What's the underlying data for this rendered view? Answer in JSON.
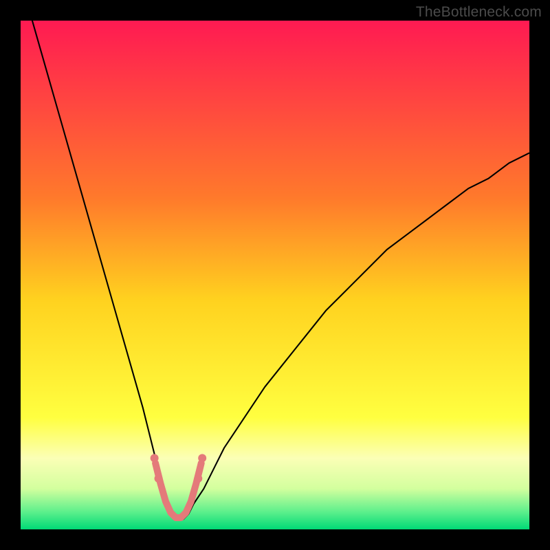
{
  "watermark": "TheBottleneck.com",
  "chart_data": {
    "type": "line",
    "title": "",
    "xlabel": "",
    "ylabel": "",
    "xlim": [
      0,
      100
    ],
    "ylim": [
      0,
      100
    ],
    "background_gradient_stops": [
      {
        "offset": 0.0,
        "color": "#ff1a52"
      },
      {
        "offset": 0.35,
        "color": "#ff7a2b"
      },
      {
        "offset": 0.55,
        "color": "#ffd21f"
      },
      {
        "offset": 0.78,
        "color": "#ffff40"
      },
      {
        "offset": 0.86,
        "color": "#fbffb6"
      },
      {
        "offset": 0.92,
        "color": "#d3ff9e"
      },
      {
        "offset": 0.965,
        "color": "#5ef08c"
      },
      {
        "offset": 1.0,
        "color": "#00d976"
      }
    ],
    "series": [
      {
        "name": "bottleneck-curve",
        "color": "#000000",
        "width": 2.1,
        "x": [
          0,
          2,
          4,
          6,
          8,
          10,
          12,
          14,
          16,
          18,
          20,
          22,
          24,
          26,
          27,
          28,
          29,
          30,
          31,
          32,
          33,
          34,
          36,
          38,
          40,
          44,
          48,
          52,
          56,
          60,
          64,
          68,
          72,
          76,
          80,
          84,
          88,
          92,
          96,
          100
        ],
        "y": [
          108,
          101,
          94,
          87,
          80,
          73,
          66,
          59,
          52,
          45,
          38,
          31,
          24,
          16,
          12,
          8,
          5,
          3,
          2,
          2,
          3,
          5,
          8,
          12,
          16,
          22,
          28,
          33,
          38,
          43,
          47,
          51,
          55,
          58,
          61,
          64,
          67,
          69,
          72,
          74
        ]
      },
      {
        "name": "valley-band",
        "color": "#e47a7a",
        "width": 10,
        "linecap": "round",
        "x": [
          26.5,
          27.5,
          28.5,
          29.5,
          30.5,
          31.5,
          32.5,
          33.5,
          34.5,
          35.5
        ],
        "y": [
          13,
          9,
          5.5,
          3.3,
          2.3,
          2.3,
          3.3,
          5.5,
          9,
          13
        ]
      }
    ],
    "scatter": [
      {
        "name": "marker-left-upper",
        "x": 26.3,
        "y": 14,
        "r": 6,
        "color": "#e47a7a"
      },
      {
        "name": "marker-left-lower",
        "x": 27.1,
        "y": 10,
        "r": 6,
        "color": "#e47a7a"
      },
      {
        "name": "marker-right-lower",
        "x": 34.9,
        "y": 10,
        "r": 6,
        "color": "#e47a7a"
      },
      {
        "name": "marker-right-upper",
        "x": 35.7,
        "y": 14,
        "r": 6,
        "color": "#e47a7a"
      }
    ]
  }
}
